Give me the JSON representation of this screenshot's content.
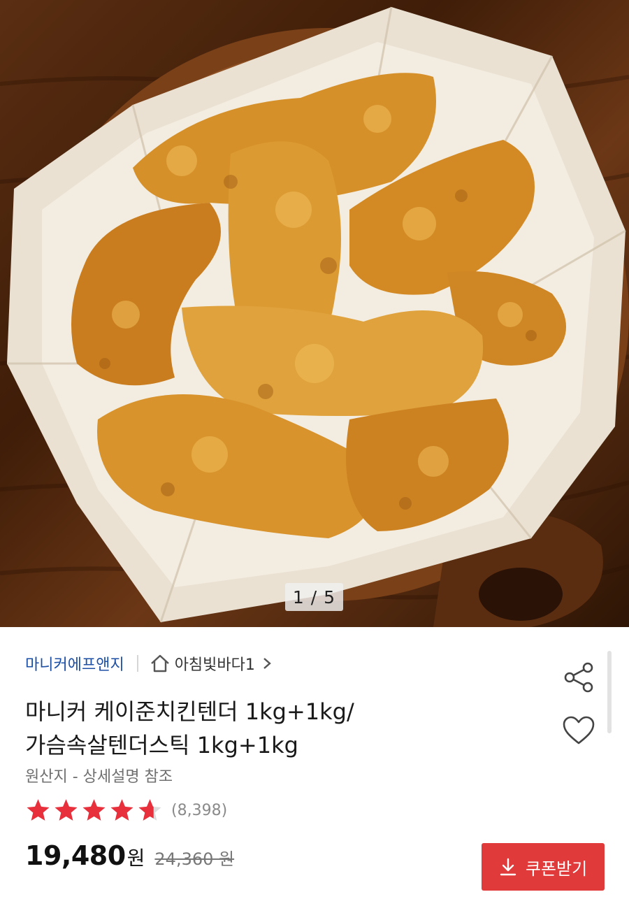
{
  "gallery": {
    "pager": "1 / 5"
  },
  "product": {
    "seller": "마니커에프앤지",
    "store": "아침빛바다1",
    "title_line1": "마니커 케이준치킨텐더 1kg+1kg/",
    "title_line2": "가슴속살텐더스틱 1kg+1kg",
    "origin": "원산지 - 상세설명 참조",
    "rating": 4.5,
    "review_count": "(8,398)",
    "price": "19,480",
    "price_unit": "원",
    "original_price": "24,360 원",
    "coupon_label": "쿠폰받기"
  },
  "colors": {
    "seller_link": "#1d4fa5",
    "star": "#e8303c",
    "coupon_bg": "#e13a3a"
  },
  "icons": [
    "home-icon",
    "chevron-right-icon",
    "share-icon",
    "heart-icon",
    "star-icon",
    "download-icon"
  ]
}
